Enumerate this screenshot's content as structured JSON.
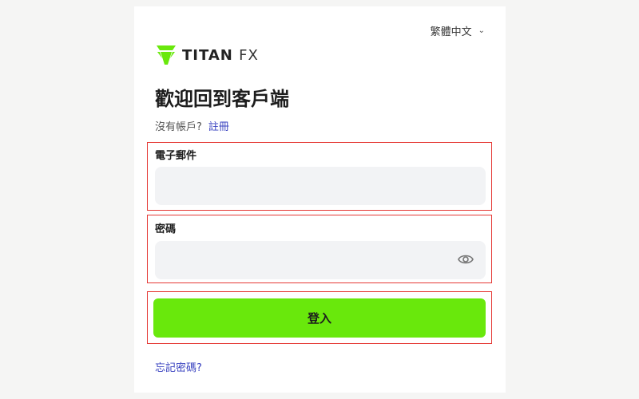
{
  "header": {
    "language_label": "繁體中文",
    "brand_main": "TITAN",
    "brand_suffix": "FX"
  },
  "main": {
    "title": "歡迎回到客戶端",
    "no_account_text": "沒有帳戶?",
    "signup_link": "註冊",
    "email_label": "電子郵件",
    "email_value": "",
    "email_placeholder": "",
    "password_label": "密碼",
    "password_value": "",
    "password_placeholder": "",
    "login_button": "登入",
    "forgot_link": "忘記密碼?"
  },
  "colors": {
    "accent_green": "#69e80c",
    "link_blue": "#3a43c0",
    "highlight_red": "#e53935"
  }
}
